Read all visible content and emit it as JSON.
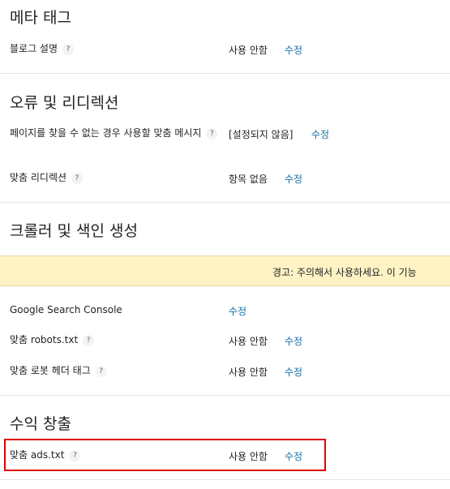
{
  "meta_tags": {
    "title": "메타 태그",
    "rows": [
      {
        "label": "블로그 설명",
        "help": "?",
        "value": "사용 안함",
        "edit": "수정"
      }
    ]
  },
  "errors_redirects": {
    "title": "오류 및 리디렉션",
    "rows": [
      {
        "label": "페이지를 찾을 수 없는 경우 사용할 맞춤 메시지",
        "help": "?",
        "value": "[설정되지 않음]",
        "edit": "수정"
      },
      {
        "label": "맞춤 리디렉션",
        "help": "?",
        "value": "항목 없음",
        "edit": "수정"
      }
    ]
  },
  "crawlers_indexing": {
    "title": "크롤러 및 색인 생성",
    "warning": "경고: 주의해서 사용하세요. 이 기능",
    "rows": [
      {
        "label": "Google Search Console",
        "edit": "수정"
      },
      {
        "label": "맞춤 robots.txt",
        "help": "?",
        "value": "사용 안함",
        "edit": "수정"
      },
      {
        "label": "맞춤 로봇 헤더 태그",
        "help": "?",
        "value": "사용 안함",
        "edit": "수정"
      }
    ]
  },
  "monetization": {
    "title": "수익 창출",
    "rows": [
      {
        "label": "맞춤 ads.txt",
        "help": "?",
        "value": "사용 안함",
        "edit": "수정"
      }
    ]
  },
  "colors": {
    "link": "#1b6fa8",
    "warning_background": "#fff3c5",
    "highlight_border": "#e00000",
    "divider": "#e6e6e6"
  }
}
